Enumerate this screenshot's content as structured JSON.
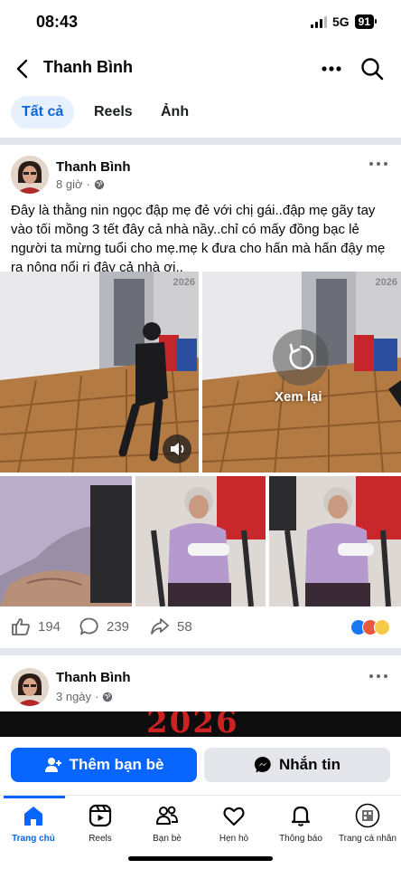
{
  "status_bar": {
    "time": "08:43",
    "network": "5G",
    "battery": "91"
  },
  "header": {
    "title": "Thanh Bình"
  },
  "tabs": [
    {
      "label": "Tất cả",
      "active": true
    },
    {
      "label": "Reels",
      "active": false
    },
    {
      "label": "Ảnh",
      "active": false
    }
  ],
  "post1": {
    "author": "Thanh Bình",
    "time": "8 giờ",
    "text": "Đây là thằng nin ngọc đập mẹ đẻ với chị gái..đập mẹ gãy tay vào tối mồng 3 tết đây cả nhà nầy..chỉ có mấy đồng bạc lẻ người ta mừng tuổi cho mẹ.mẹ k đưa cho hấn mà hấn đậy mẹ ra nông nổi ri đây cả nhà ơi..",
    "video_watermark": "2026",
    "replay_label": "Xem lại",
    "likes": "194",
    "comments": "239",
    "shares": "58"
  },
  "post2": {
    "author": "Thanh Bình",
    "time": "3 ngày",
    "banner_text": "2026"
  },
  "cta": {
    "add_friend": "Thêm bạn bè",
    "message": "Nhắn tin"
  },
  "bottom_nav": [
    {
      "label": "Trang chủ",
      "icon": "home-icon",
      "active": true
    },
    {
      "label": "Reels",
      "icon": "reels-icon",
      "active": false
    },
    {
      "label": "Bạn bè",
      "icon": "friends-icon",
      "active": false
    },
    {
      "label": "Hẹn hò",
      "icon": "dating-heart-icon",
      "active": false
    },
    {
      "label": "Thông báo",
      "icon": "bell-icon",
      "active": false
    },
    {
      "label": "Trang cá nhân",
      "icon": "profile-icon",
      "active": false
    }
  ],
  "colors": {
    "brand": "#0866ff",
    "active_tab_bg": "#e7f0fd",
    "divider": "#e4e6eb",
    "secondary_text": "#65676b"
  }
}
